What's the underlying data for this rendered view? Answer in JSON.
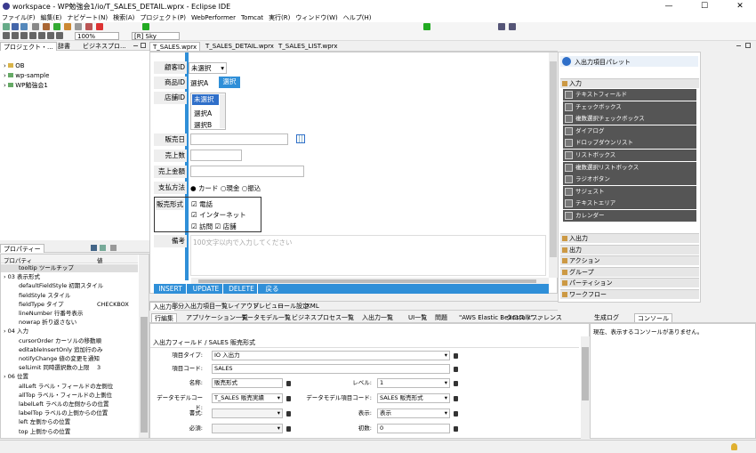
{
  "window": {
    "title": "workspace - WP勉強会1/io/T_SALES_DETAIL.wprx - Eclipse IDE",
    "min": "—",
    "max": "☐",
    "close": "✕"
  },
  "menu": [
    "ファイル(F)",
    "編集(E)",
    "ナビゲート(N)",
    "検索(A)",
    "プロジェクト(P)",
    "WebPerformer",
    "Tomcat",
    "実行(R)",
    "ウィンドウ(W)",
    "ヘルプ(H)"
  ],
  "toolbar": {
    "zoom": "100%",
    "sky": "[R] Sky"
  },
  "left_tabs": {
    "project": "プロジェクト・...",
    "dict": "辞書",
    "bp": "ビジネスプロ..."
  },
  "tree": [
    "OB",
    "wp-sample",
    "WP勉強会1"
  ],
  "editor_tabs": [
    "T_SALES.wprx",
    "T_SALES_DETAIL.wprx",
    "T_SALES_LIST.wprx"
  ],
  "form": {
    "customer_label": "顧客ID",
    "customer_value": "未選択",
    "product_label": "商品ID",
    "product_value": "選択A",
    "product_btn": "選択",
    "store_label": "店舗ID",
    "store_options": [
      "未選択",
      "選択A",
      "選択B"
    ],
    "date_label": "販売日",
    "qty_label": "売上数",
    "amount_label": "売上金額",
    "pay_label": "支払方法",
    "pay_options": [
      "カード",
      "現金",
      "振込"
    ],
    "type_label": "販売形式",
    "type_options": [
      "電話",
      "インターネット",
      "訪問",
      "店舗"
    ],
    "note_label": "備考",
    "note_placeholder": "100文字以内で入力してください",
    "buttons": [
      "INSERT",
      "UPDATE",
      "DELETE",
      "戻る"
    ]
  },
  "editor_bottom_tabs": [
    "入出力",
    "部分入出力",
    "項目一覧",
    "レイアウト",
    "プレビュー",
    "ロール設定",
    "XML"
  ],
  "palette": {
    "title": "入出力項目パレット",
    "section_in": "入力",
    "items": [
      "テキストフィールド",
      "チェックボックス",
      "複数選択チェックボックス",
      "ダイアログ",
      "ドロップダウンリスト",
      "リストボックス",
      "複数選択リストボックス",
      "ラジオボタン",
      "サジェスト",
      "テキストエリア",
      "カレンダー"
    ],
    "sections": [
      "入出力",
      "出力",
      "アクション",
      "グループ",
      "パーティション",
      "ワークフロー"
    ]
  },
  "props": {
    "tab": "プロパティー",
    "col_prop": "プロパティ",
    "col_val": "値",
    "rows": [
      {
        "n": "tooltip ツールチップ",
        "v": ""
      },
      {
        "n": "› 03 表示形式",
        "v": ""
      },
      {
        "n": "defaultFieldStyle 初期スタイル",
        "v": ""
      },
      {
        "n": "fieldStyle スタイル",
        "v": ""
      },
      {
        "n": "fieldType タイプ",
        "v": "CHECKBOX"
      },
      {
        "n": "lineNumber 行番号表示",
        "v": ""
      },
      {
        "n": "nowrap 折り返さない",
        "v": ""
      },
      {
        "n": "› 04 入力",
        "v": ""
      },
      {
        "n": "cursorOrder カーソルの移動順",
        "v": ""
      },
      {
        "n": "editableInsertOnly 追加行のみ",
        "v": ""
      },
      {
        "n": "notifyChange 値の変更を通知",
        "v": ""
      },
      {
        "n": "selLimit 同時選択数の上限",
        "v": "3"
      },
      {
        "n": "› 06 位置",
        "v": ""
      },
      {
        "n": "allLeft ラベル・フィールドの左側位",
        "v": ""
      },
      {
        "n": "allTop ラベル・フィールドの上側位",
        "v": ""
      },
      {
        "n": "labelLeft ラベルの左側からの位置",
        "v": ""
      },
      {
        "n": "labelTop ラベルの上側からの位置",
        "v": ""
      },
      {
        "n": "left 左側からの位置",
        "v": ""
      },
      {
        "n": "top 上側からの位置",
        "v": ""
      }
    ]
  },
  "bottom_tabs": [
    "行編集",
    "アプリケーション一覧",
    "データモデル一覧",
    "ビジネスプロセス一覧",
    "入出力一覧",
    "UI一覧",
    "問題",
    "\"AWS Elastic Beanstalk\"...",
    "クロスリファレンス"
  ],
  "detail": {
    "header": "入出力フィールド / SALES 販売形式",
    "type_label": "項目タイプ:",
    "type_value": "IO 入出力",
    "code_label": "項目コード:",
    "code_value": "SALES",
    "name_label": "名称:",
    "name_value": "販売形式",
    "level_label": "レベル:",
    "level_value": "1",
    "dm_label": "データモデルコード:",
    "dm_value": "T_SALES 販売実績",
    "dmi_label": "データモデル項目コード:",
    "dmi_value": "SALES 販売形式",
    "fmt_label": "書式:",
    "fmt_value": "",
    "disp_label": "表示:",
    "disp_value": "表示",
    "req_label": "必須:",
    "req_value": "",
    "init_label": "初数:",
    "init_value": "0"
  },
  "console": {
    "tabs": [
      "生成ログ",
      "コンソール"
    ],
    "msg": "現在、表示するコンソールがありません。"
  }
}
